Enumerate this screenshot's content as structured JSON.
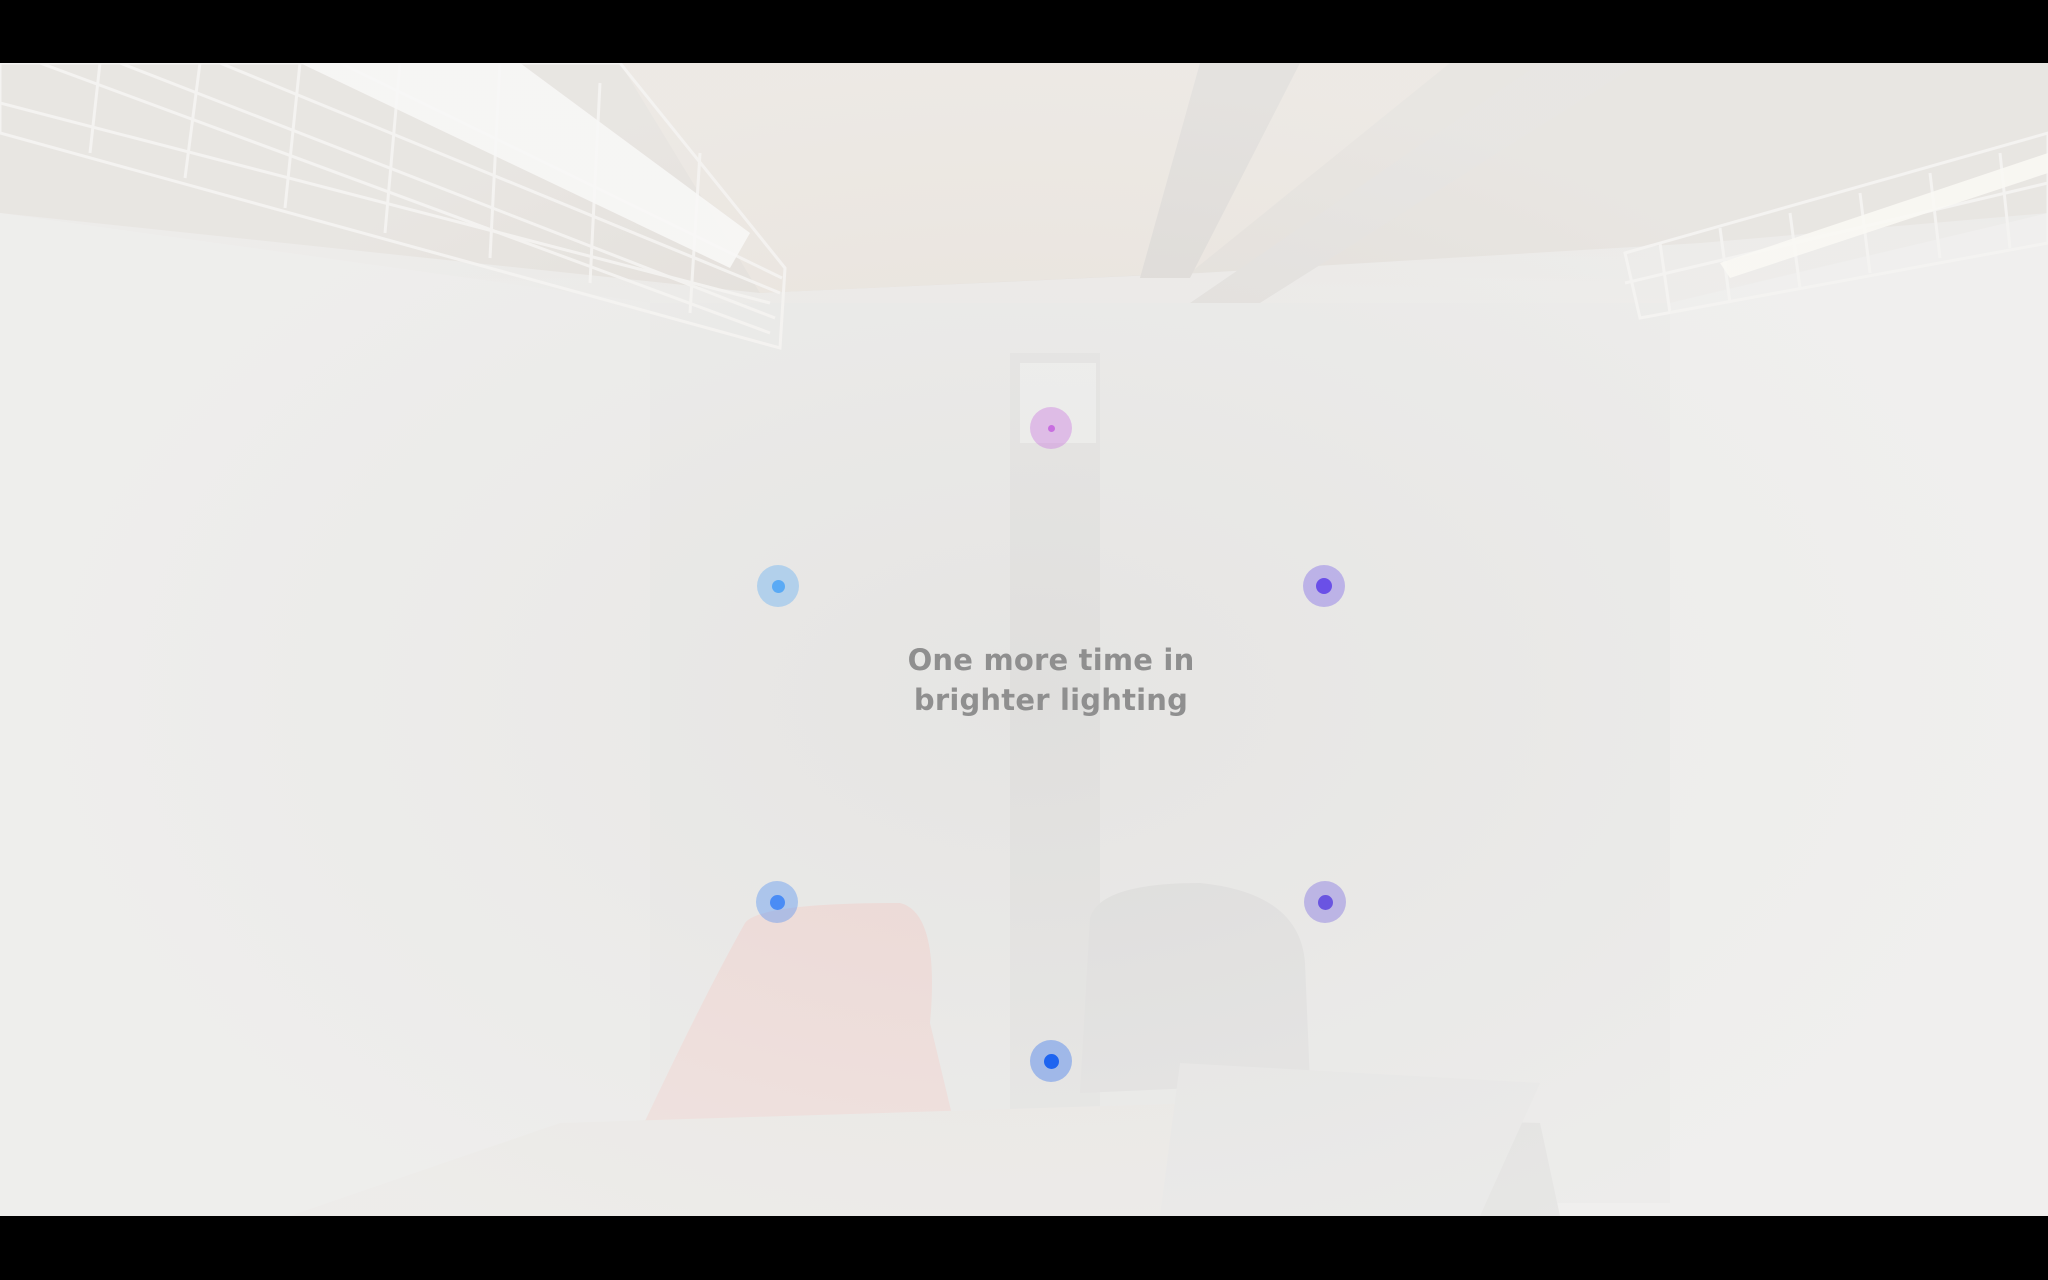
{
  "prompt": {
    "line1": "One more time in",
    "line2": "brighter lighting"
  },
  "colors": {
    "letterbox": "#000000",
    "prompt_text": "#8f8f8f",
    "dot_top": "#c86ee0",
    "dot_upper_left": "#5aaaf5",
    "dot_upper_right": "#6a4fe8",
    "dot_lower_left": "#4a8cf5",
    "dot_lower_right": "#6a55e0",
    "dot_bottom": "#1e64f0"
  }
}
